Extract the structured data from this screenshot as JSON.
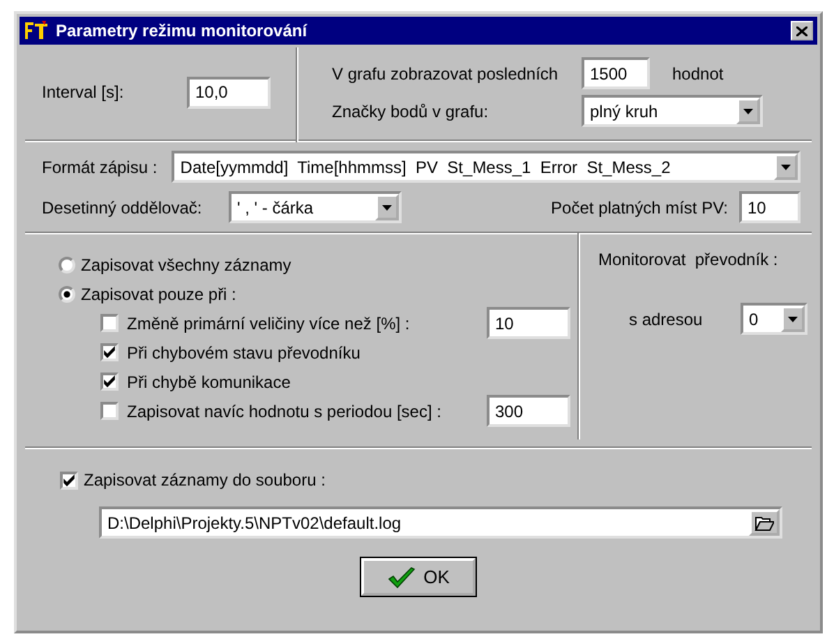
{
  "window": {
    "title": "Parametry režimu monitorování"
  },
  "interval": {
    "label": "Interval [s]:",
    "value": "10,0"
  },
  "graph": {
    "points_label": "V grafu zobrazovat posledních",
    "points_value": "1500",
    "points_unit": "hodnot",
    "markers_label": "Značky bodů v grafu:",
    "markers_value": "plný kruh"
  },
  "format": {
    "label": "Formát zápisu :",
    "value": "Date[yymmdd]  Time[hhmmss]  PV  St_Mess_1  Error  St_Mess_2"
  },
  "decimal": {
    "label": "Desetinný oddělovač:",
    "value": "' , ' - čárka"
  },
  "digits": {
    "label": "Počet platných míst PV:",
    "value": "10"
  },
  "record_modes": [
    {
      "label": "Zapisovat všechny záznamy",
      "selected": false
    },
    {
      "label": "Zapisovat pouze při :",
      "selected": true
    }
  ],
  "conditions": [
    {
      "label": "Změně primární veličiny více než [%] :",
      "checked": false,
      "value": "10"
    },
    {
      "label": "Při chybovém stavu převodníku",
      "checked": true
    },
    {
      "label": "Při chybě komunikace",
      "checked": true
    },
    {
      "label": "Zapisovat navíc hodnotu s periodou [sec] :",
      "checked": false,
      "value": "300"
    }
  ],
  "monitor": {
    "label": "Monitorovat  převodník :",
    "address_label": "s adresou",
    "address_value": "0"
  },
  "file": {
    "label": "Zapisovat záznamy do souboru :",
    "checked": true,
    "path": "D:\\Delphi\\Projekty.5\\NPTv02\\default.log"
  },
  "ok_button": {
    "label": "OK"
  }
}
